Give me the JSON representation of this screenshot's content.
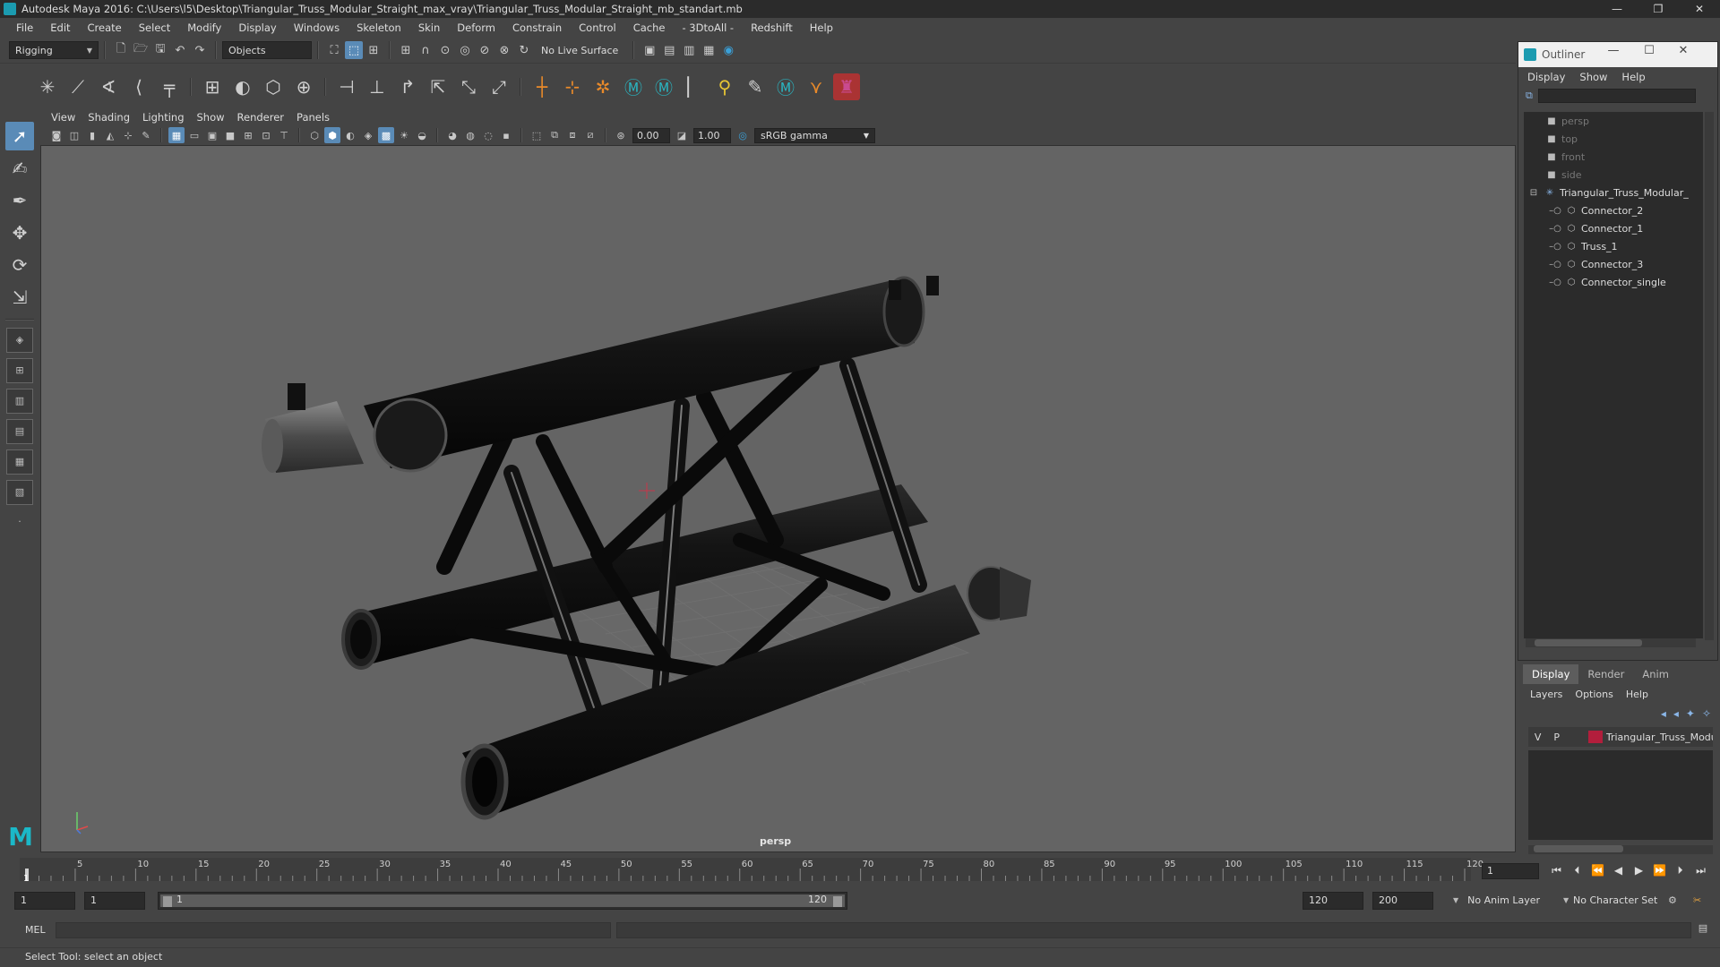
{
  "window": {
    "title": "Autodesk Maya 2016: C:\\Users\\l5\\Desktop\\Triangular_Truss_Modular_Straight_max_vray\\Triangular_Truss_Modular_Straight_mb_standart.mb",
    "minimize": "—",
    "maximize": "❐",
    "close": "✕"
  },
  "menubar": [
    "File",
    "Edit",
    "Create",
    "Select",
    "Modify",
    "Display",
    "Windows",
    "Skeleton",
    "Skin",
    "Deform",
    "Constrain",
    "Control",
    "Cache",
    "- 3DtoAll -",
    "Redshift",
    "Help"
  ],
  "statusline": {
    "menuset": "Rigging",
    "selection_mode": "Objects",
    "live_surface": "No Live Surface"
  },
  "viewport": {
    "menus": [
      "View",
      "Shading",
      "Lighting",
      "Show",
      "Renderer",
      "Panels"
    ],
    "exposure": "0.00",
    "gamma": "1.00",
    "color_management": "sRGB gamma",
    "camera_label": "persp"
  },
  "outliner": {
    "title": "Outliner",
    "menus": [
      "Display",
      "Show",
      "Help"
    ],
    "items": [
      {
        "label": "persp",
        "type": "camera",
        "dim": true,
        "indent": 0
      },
      {
        "label": "top",
        "type": "camera",
        "dim": true,
        "indent": 0
      },
      {
        "label": "front",
        "type": "camera",
        "dim": true,
        "indent": 0
      },
      {
        "label": "side",
        "type": "camera",
        "dim": true,
        "indent": 0
      },
      {
        "label": "Triangular_Truss_Modular_",
        "type": "group",
        "dim": false,
        "indent": 0
      },
      {
        "label": "Connector_2",
        "type": "mesh",
        "dim": false,
        "indent": 1
      },
      {
        "label": "Connector_1",
        "type": "mesh",
        "dim": false,
        "indent": 1
      },
      {
        "label": "Truss_1",
        "type": "mesh",
        "dim": false,
        "indent": 1
      },
      {
        "label": "Connector_3",
        "type": "mesh",
        "dim": false,
        "indent": 1
      },
      {
        "label": "Connector_single",
        "type": "mesh",
        "dim": false,
        "indent": 1
      }
    ]
  },
  "layer_editor": {
    "tabs": [
      "Display",
      "Render",
      "Anim"
    ],
    "active_tab": "Display",
    "menus": [
      "Layers",
      "Options",
      "Help"
    ],
    "layers": [
      {
        "visible": "V",
        "playback": "P",
        "color": "#b21e3c",
        "name": "Triangular_Truss_Modu"
      }
    ]
  },
  "timeslider": {
    "ticks": [
      "5",
      "10",
      "15",
      "20",
      "25",
      "30",
      "35",
      "40",
      "45",
      "50",
      "55",
      "60",
      "65",
      "70",
      "75",
      "80",
      "85",
      "90",
      "95",
      "100",
      "105",
      "110",
      "115",
      "120"
    ],
    "current_marker": "1",
    "current_time": "1"
  },
  "range": {
    "start_time": "1",
    "playback_start": "1",
    "slider_start": "1",
    "slider_end": "120",
    "playback_end": "120",
    "end_time": "200",
    "anim_layer": "No Anim Layer",
    "character_set": "No Character Set"
  },
  "command": {
    "language": "MEL"
  },
  "help_line": "Select Tool: select an object",
  "colors": {
    "accent": "#5a8bb7",
    "maya_teal": "#1b9bb0",
    "layer_color": "#b21e3c"
  }
}
